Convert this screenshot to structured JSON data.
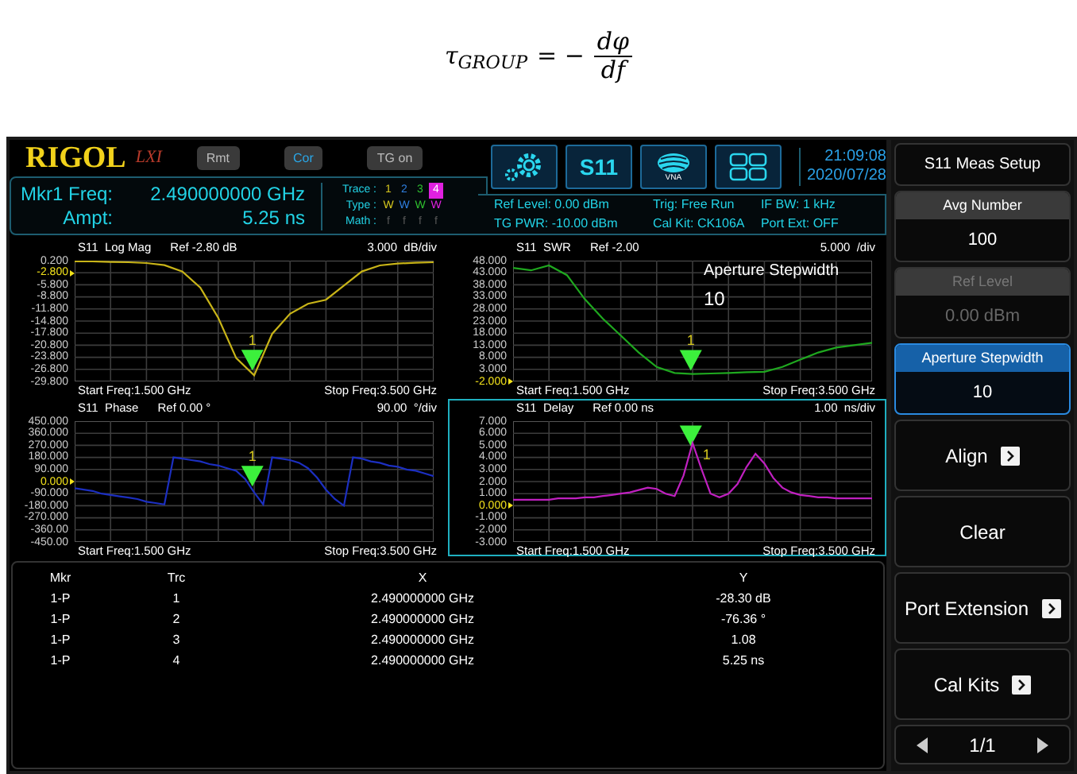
{
  "formula": {
    "lhs": "τ$_{GROUP}$",
    "sign": "= −",
    "numerator": "dφ",
    "denominator": "df"
  },
  "header": {
    "logo": "RIGOL",
    "lxi": "LXI",
    "status_buttons": [
      {
        "label": "Rmt",
        "on": false
      },
      {
        "label": "Cor",
        "on": true
      },
      {
        "label": "TG on",
        "on": false
      }
    ],
    "toolbar": [
      {
        "kind": "gear"
      },
      {
        "kind": "text",
        "label": "S11"
      },
      {
        "kind": "vna",
        "label": "VNA"
      },
      {
        "kind": "layout"
      }
    ],
    "time": "21:09:08",
    "date": "2020/07/28"
  },
  "marker_info": {
    "freq_label": "Mkr1 Freq:",
    "freq_value": "2.490000000 GHz",
    "ampt_label": "Ampt:",
    "ampt_value": "5.25 ns"
  },
  "traces": {
    "labels": [
      "Trace :",
      "Type :",
      "Math :"
    ],
    "items": [
      {
        "number": "1",
        "type": "W",
        "math": "f",
        "color": "#d6c81e",
        "selected": false
      },
      {
        "number": "2",
        "type": "W",
        "math": "f",
        "color": "#2f7fe0",
        "selected": false
      },
      {
        "number": "3",
        "type": "W",
        "math": "f",
        "color": "#2fc02f",
        "selected": false
      },
      {
        "number": "4",
        "type": "W",
        "math": "f",
        "color": "#e020e0",
        "selected": true
      }
    ]
  },
  "settings": [
    "Ref Level: 0.00 dBm",
    "TG PWR: -10.00 dBm",
    "Trig: Free Run",
    "Cal Kit: CK106A",
    "IF BW: 1 kHz",
    "Port Ext: OFF"
  ],
  "plots": [
    {
      "ref": "Ref -2.80 dB",
      "scale": "3.000  dB/div",
      "start": "Start Freq:1.500 GHz",
      "stop": "Stop Freq:3.500 GHz",
      "selected": false,
      "marker_label": "1",
      "reference_ticks": [
        false,
        true,
        false,
        false,
        false,
        false,
        false,
        false,
        false,
        false,
        false
      ],
      "chart_data": {
        "type": "line",
        "title": "S11  Log Mag",
        "grid": true,
        "categories": [
          null,
          null,
          null,
          null,
          null,
          null,
          null,
          null,
          null,
          null,
          null,
          null,
          null,
          null,
          null,
          null,
          null,
          null,
          null,
          null,
          null
        ],
        "series": [
          {
            "color": "#c8b418",
            "values": [
              0.0,
              0.0,
              -0.1,
              -0.2,
              -0.4,
              -0.9,
              -2.5,
              -6.5,
              -14,
              -24,
              -28.3,
              -18,
              -13,
              -10.5,
              -9.5,
              -6,
              -2.5,
              -1,
              -0.5,
              -0.3,
              -0.2
            ]
          }
        ],
        "ylim": [
          -29.8,
          0.2
        ],
        "yticks": [
          {
            "value": 0.2,
            "label": "0.200"
          },
          {
            "value": -2.8,
            "label": "-2.800"
          },
          {
            "value": -5.8,
            "label": "-5.800"
          },
          {
            "value": -8.8,
            "label": "-8.800"
          },
          {
            "value": -11.8,
            "label": "-11.800"
          },
          {
            "value": -14.8,
            "label": "-14.800"
          },
          {
            "value": -17.8,
            "label": "-17.800"
          },
          {
            "value": -20.8,
            "label": "-20.800"
          },
          {
            "value": -23.8,
            "label": "-23.800"
          },
          {
            "value": -26.8,
            "label": "-26.800"
          },
          {
            "value": -29.8,
            "label": "-29.800"
          }
        ]
      }
    },
    {
      "ref": "Ref -2.00",
      "scale": "5.000  /div",
      "start": "Start Freq:1.500 GHz",
      "stop": "Stop Freq:3.500 GHz",
      "selected": false,
      "marker_label": "1",
      "overlay": {
        "label": "Aperture Stepwidth",
        "value": "10"
      },
      "reference_ticks": [
        false,
        false,
        false,
        false,
        false,
        false,
        false,
        false,
        false,
        false,
        true
      ],
      "chart_data": {
        "type": "line",
        "title": "S11  SWR",
        "grid": true,
        "categories": [
          null,
          null,
          null,
          null,
          null,
          null,
          null,
          null,
          null,
          null,
          null,
          null,
          null,
          null,
          null,
          null,
          null,
          null,
          null,
          null,
          null
        ],
        "series": [
          {
            "color": "#1fa81f",
            "values": [
              45,
              44,
              46,
              42,
              32,
              24,
              17,
              10,
              4,
              1.5,
              1.1,
              1.3,
              1.5,
              1.8,
              2,
              4,
              7,
              10,
              12,
              13,
              14
            ]
          }
        ],
        "ylim": [
          -2,
          48
        ],
        "yticks": [
          {
            "value": 48,
            "label": "48.000"
          },
          {
            "value": 43,
            "label": "43.000"
          },
          {
            "value": 38,
            "label": "38.000"
          },
          {
            "value": 33,
            "label": "33.000"
          },
          {
            "value": 28,
            "label": "28.000"
          },
          {
            "value": 23,
            "label": "23.000"
          },
          {
            "value": 18,
            "label": "18.000"
          },
          {
            "value": 13,
            "label": "13.000"
          },
          {
            "value": 8,
            "label": "8.000"
          },
          {
            "value": 3,
            "label": "3.000"
          },
          {
            "value": -2,
            "label": "-2.000"
          }
        ]
      }
    },
    {
      "ref": "Ref 0.00 °",
      "scale": "90.00  °/div",
      "start": "Start Freq:1.500 GHz",
      "stop": "Stop Freq:3.500 GHz",
      "selected": false,
      "marker_label": "1",
      "reference_ticks": [
        false,
        false,
        false,
        false,
        false,
        true,
        false,
        false,
        false,
        false,
        false
      ],
      "chart_data": {
        "type": "line",
        "title": "S11  Phase",
        "grid": true,
        "categories": [
          null,
          null,
          null,
          null,
          null,
          null,
          null,
          null,
          null,
          null,
          null,
          null,
          null,
          null,
          null,
          null,
          null,
          null,
          null,
          null,
          null,
          null,
          null,
          null,
          null,
          null,
          null,
          null,
          null,
          null,
          null,
          null,
          null,
          null,
          null,
          null,
          null,
          null,
          null,
          null,
          null
        ],
        "series": [
          {
            "color": "#1c2fc0",
            "values": [
              -50,
              -60,
              -70,
              -90,
              -100,
              -110,
              -120,
              -130,
              -150,
              -160,
              -170,
              180,
              170,
              160,
              150,
              130,
              120,
              100,
              80,
              20,
              -80,
              -170,
              180,
              170,
              160,
              140,
              100,
              30,
              -60,
              -130,
              -180,
              180,
              170,
              150,
              140,
              120,
              110,
              90,
              80,
              60,
              40
            ]
          }
        ],
        "ylim": [
          -450,
          450
        ],
        "yticks": [
          {
            "value": 450,
            "label": "450.000"
          },
          {
            "value": 360,
            "label": "360.000"
          },
          {
            "value": 270,
            "label": "270.000"
          },
          {
            "value": 180,
            "label": "180.000"
          },
          {
            "value": 90,
            "label": "90.000"
          },
          {
            "value": 0,
            "label": "0.000"
          },
          {
            "value": -90,
            "label": "-90.000"
          },
          {
            "value": -180,
            "label": "-180.000"
          },
          {
            "value": -270,
            "label": "-270.000"
          },
          {
            "value": -360,
            "label": "-360.00"
          },
          {
            "value": -450,
            "label": "-450.00"
          }
        ]
      }
    },
    {
      "ref": "Ref 0.00 ns",
      "scale": "1.00  ns/div",
      "start": "Start Freq:1.500 GHz",
      "stop": "Stop Freq:3.500 GHz",
      "selected": true,
      "marker_label": "1",
      "reference_ticks": [
        false,
        false,
        false,
        false,
        false,
        false,
        false,
        true,
        false,
        false,
        false
      ],
      "chart_data": {
        "type": "line",
        "title": "S11  Delay",
        "grid": true,
        "categories": [
          null,
          null,
          null,
          null,
          null,
          null,
          null,
          null,
          null,
          null,
          null,
          null,
          null,
          null,
          null,
          null,
          null,
          null,
          null,
          null,
          null,
          null,
          null,
          null,
          null,
          null,
          null,
          null,
          null,
          null,
          null,
          null,
          null,
          null,
          null,
          null,
          null,
          null,
          null,
          null,
          null
        ],
        "series": [
          {
            "color": "#c020c0",
            "values": [
              0.5,
              0.5,
              0.5,
              0.5,
              0.5,
              0.6,
              0.6,
              0.6,
              0.7,
              0.7,
              0.8,
              0.9,
              1.0,
              1.1,
              1.3,
              1.5,
              1.4,
              1.0,
              0.8,
              2.5,
              5.2,
              3.0,
              1.0,
              0.7,
              1.0,
              1.8,
              3.2,
              4.3,
              3.5,
              2.3,
              1.5,
              1.1,
              0.9,
              0.8,
              0.7,
              0.7,
              0.6,
              0.6,
              0.6,
              0.6,
              0.6
            ]
          }
        ],
        "ylim": [
          -3,
          7
        ],
        "yticks": [
          {
            "value": 7,
            "label": "7.000"
          },
          {
            "value": 6,
            "label": "6.000"
          },
          {
            "value": 5,
            "label": "5.000"
          },
          {
            "value": 4,
            "label": "4.000"
          },
          {
            "value": 3,
            "label": "3.000"
          },
          {
            "value": 2,
            "label": "2.000"
          },
          {
            "value": 1,
            "label": "1.000"
          },
          {
            "value": 0,
            "label": "0.000"
          },
          {
            "value": -1,
            "label": "-1.000"
          },
          {
            "value": -2,
            "label": "-2.000"
          },
          {
            "value": -3,
            "label": "-3.000"
          }
        ]
      }
    }
  ],
  "marker_table": {
    "columns": [
      "Mkr",
      "Trc",
      "X",
      "Y"
    ],
    "rows": [
      [
        "1-P",
        "1",
        "2.490000000 GHz",
        "-28.30 dB"
      ],
      [
        "1-P",
        "2",
        "2.490000000 GHz",
        "-76.36 °"
      ],
      [
        "1-P",
        "3",
        "2.490000000 GHz",
        "1.08"
      ],
      [
        "1-P",
        "4",
        "2.490000000 GHz",
        "5.25 ns"
      ]
    ]
  },
  "menu": {
    "title": "S11 Meas Setup",
    "items": [
      {
        "kind": "value",
        "label": "Avg Number",
        "value": "100",
        "disabled": false,
        "selected": false
      },
      {
        "kind": "value",
        "label": "Ref Level",
        "value": "0.00 dBm",
        "disabled": true,
        "selected": false
      },
      {
        "kind": "value",
        "label": "Aperture Stepwidth",
        "value": "10",
        "disabled": false,
        "selected": true
      },
      {
        "kind": "submenu",
        "label": "Align",
        "disabled": false,
        "selected": false
      },
      {
        "kind": "action",
        "label": "Clear",
        "disabled": false,
        "selected": false
      },
      {
        "kind": "submenu",
        "label": "Port Extension",
        "disabled": false,
        "selected": false
      },
      {
        "kind": "submenu",
        "label": "Cal Kits",
        "disabled": false,
        "selected": false
      }
    ],
    "page": "1/1"
  }
}
